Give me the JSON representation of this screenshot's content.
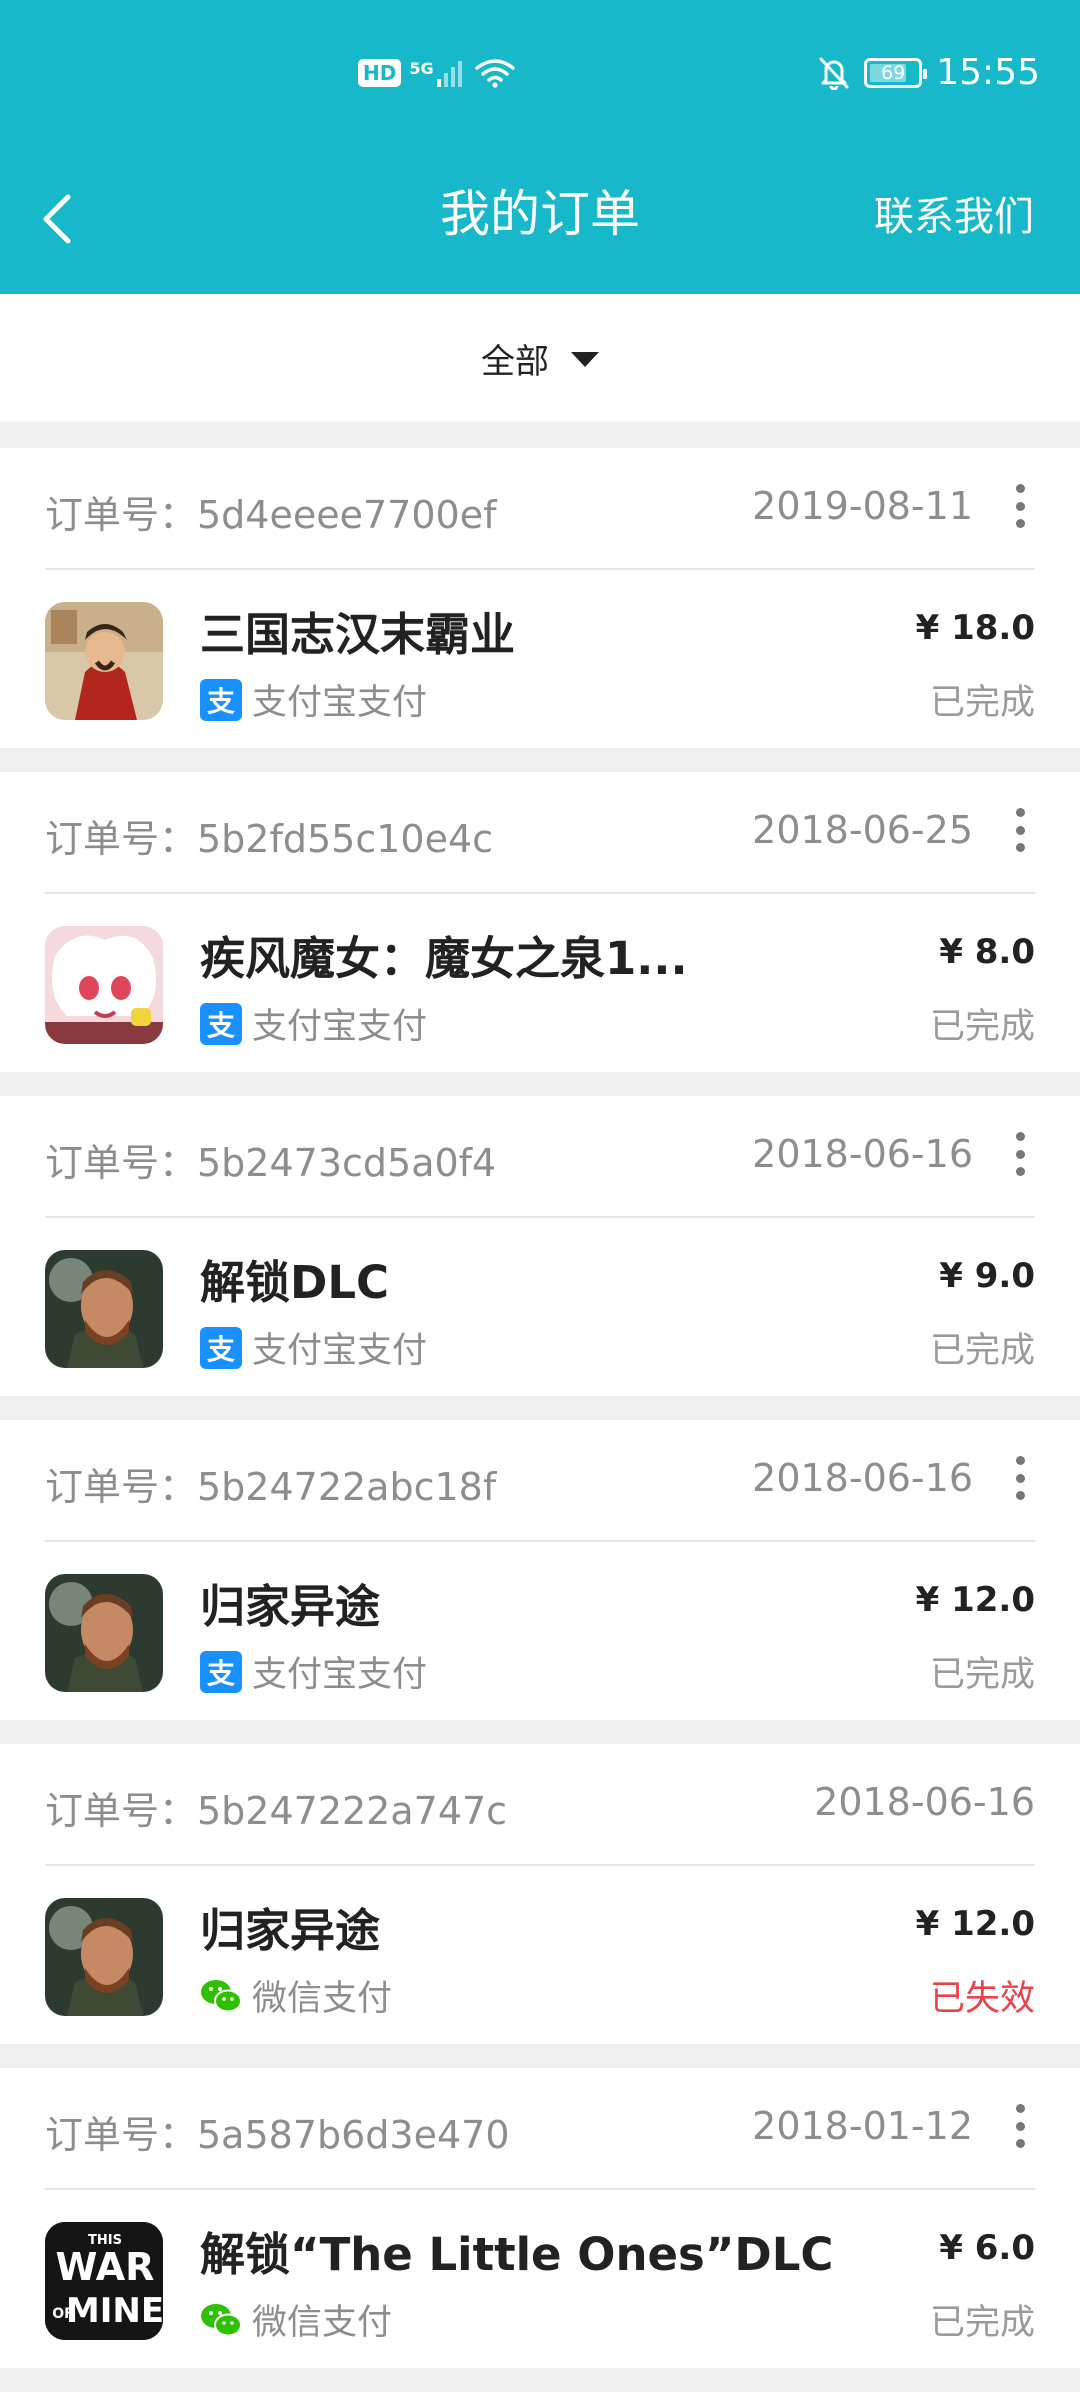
{
  "status_bar": {
    "hd": "HD",
    "network": "5G",
    "battery": "69",
    "time": "15:55"
  },
  "header": {
    "title": "我的订单",
    "contact": "联系我们"
  },
  "filter": {
    "label": "全部"
  },
  "orders": [
    {
      "order_label": "订单号：5d4eeee7700ef",
      "date": "2019-08-11",
      "game": "三国志汉末霸业",
      "pay_method": "支付宝支付",
      "price": "¥ 18.0",
      "state": "已完成"
    },
    {
      "order_label": "订单号：5b2fd55c10e4c",
      "date": "2018-06-25",
      "game": "疾风魔女：魔女之泉1...",
      "pay_method": "支付宝支付",
      "price": "¥ 8.0",
      "state": "已完成"
    },
    {
      "order_label": "订单号：5b2473cd5a0f4",
      "date": "2018-06-16",
      "game": "解锁DLC",
      "pay_method": "支付宝支付",
      "price": "¥ 9.0",
      "state": "已完成"
    },
    {
      "order_label": "订单号：5b24722abc18f",
      "date": "2018-06-16",
      "game": "归家异途",
      "pay_method": "支付宝支付",
      "price": "¥ 12.0",
      "state": "已完成"
    },
    {
      "order_label": "订单号：5b247222a747c",
      "date": "2018-06-16",
      "game": "归家异途",
      "pay_method": "微信支付",
      "price": "¥ 12.0",
      "state": "已失效"
    },
    {
      "order_label": "订单号：5a587b6d3e470",
      "date": "2018-01-12",
      "game": "解锁“The Little Ones”DLC",
      "pay_method": "微信支付",
      "price": "¥ 6.0",
      "state": "已完成",
      "icon_text": [
        "THIS",
        "WAR",
        "OF",
        "MINE"
      ]
    }
  ],
  "colors": {
    "header_bg": "#16b8c9",
    "alipay_blue": "#1890ff",
    "wechat_green": "#2dc100",
    "failed_red": "#e8434a"
  },
  "icons": {
    "back": "chevron-left-icon",
    "more": "more-vertical-icon",
    "dropdown": "caret-down-icon",
    "alipay": "alipay-icon",
    "wechat": "wechat-pay-icon"
  }
}
